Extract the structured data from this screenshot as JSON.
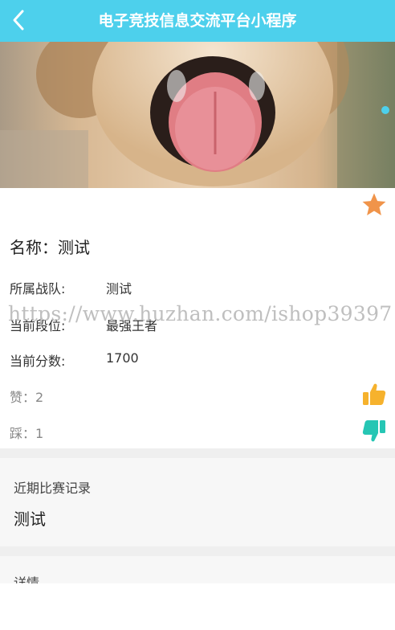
{
  "header": {
    "title": "电子竞技信息交流平台小程序",
    "back_icon": "chevron-left-icon"
  },
  "banner": {
    "image_desc_icon": "dog-photo"
  },
  "favorite": {
    "icon": "star-icon",
    "color": "#f0944a"
  },
  "item": {
    "name_label": "名称：",
    "name_value": "测试",
    "fields": [
      {
        "label": "所属战队:",
        "value": "测试"
      },
      {
        "label": "当前段位:",
        "value": "最强王者"
      },
      {
        "label": "当前分数:",
        "value": "1700"
      }
    ],
    "likes": {
      "label": "赞：",
      "value": "2",
      "icon": "thumbs-up-icon",
      "color": "#f6b22d"
    },
    "dislikes": {
      "label": "踩：",
      "value": "1",
      "icon": "thumbs-down-icon",
      "color": "#26c6b4"
    }
  },
  "sections": {
    "recent_title": "近期比赛记录",
    "recent_body": "测试",
    "detail_title": "详情"
  },
  "watermark": "https://www.huzhan.com/ishop39397",
  "colors": {
    "accent": "#4dd0ec"
  }
}
